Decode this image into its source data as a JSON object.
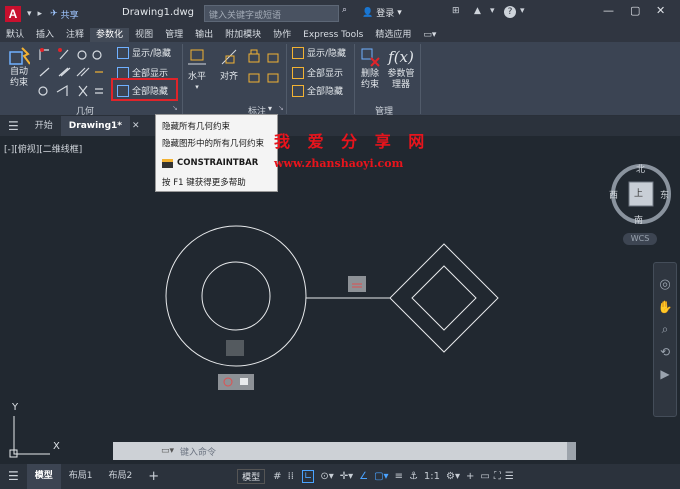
{
  "titlebar": {
    "logo": "A",
    "share": "共享",
    "doc_title": "Drawing1.dwg",
    "search_placeholder": "键入关键字或短语",
    "login": "登录"
  },
  "menu": [
    "默认",
    "插入",
    "注释",
    "参数化",
    "视图",
    "管理",
    "输出",
    "附加模块",
    "协作",
    "Express Tools",
    "精选应用"
  ],
  "menu_active_index": 3,
  "ribbon": {
    "geometry_panel_label": "几何",
    "auto_constrain_label": "自动约束",
    "geo_buttons": [
      "显示/隐藏",
      "全部显示",
      "全部隐藏"
    ],
    "dim_buttons": [
      "水平",
      "对齐"
    ],
    "dim_panel_label": "标注",
    "dim_show_buttons": [
      "显示/隐藏",
      "全部显示",
      "全部隐藏"
    ],
    "manage_delete": "删除约束",
    "manage_params": "参数管理器",
    "manage_panel_label": "管理"
  },
  "tabs": {
    "start": "开始",
    "drawing": "Drawing1*"
  },
  "viewport_label": "[-][俯视][二维线框]",
  "tooltip": {
    "title": "隐藏所有几何约束",
    "desc": "隐藏图形中的所有几何约束",
    "command": "CONSTRAINTBAR",
    "help": "按 F1 键获得更多帮助"
  },
  "watermark": {
    "line1": "我 爱 分 享 网",
    "line2": "www.zhanshaoyi.com"
  },
  "viewcube": {
    "north": "北",
    "south": "南",
    "east": "东",
    "west": "西",
    "top": "上",
    "wcs": "WCS"
  },
  "ucs": {
    "x": "X",
    "y": "Y"
  },
  "cmdline_placeholder": "键入命令",
  "status": {
    "model_tab": "模型",
    "layout1": "布局1",
    "layout2": "布局2",
    "model_btn": "模型",
    "scale": "1:1"
  },
  "colors": {
    "accent": "#1e82d2",
    "highlight": "#e0242a",
    "watermark": "#e8141c"
  }
}
